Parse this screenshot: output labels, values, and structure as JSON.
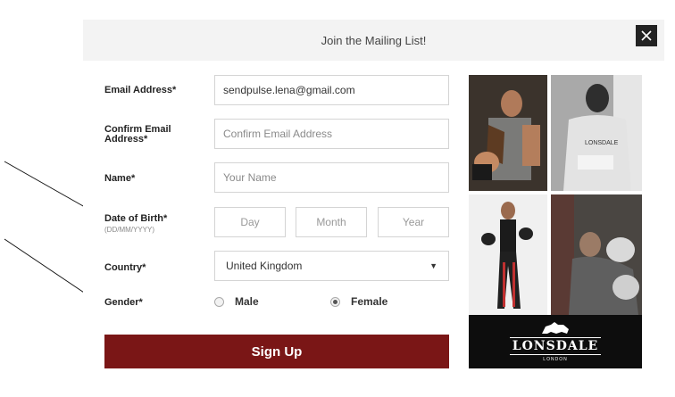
{
  "modal": {
    "title": "Join the Mailing List!",
    "close_icon": "close-icon"
  },
  "form": {
    "email": {
      "label": "Email Address*",
      "value": "sendpulse.lena@gmail.com",
      "placeholder": ""
    },
    "confirm_email": {
      "label": "Confirm Email Address*",
      "value": "",
      "placeholder": "Confirm Email Address"
    },
    "name": {
      "label": "Name*",
      "value": "",
      "placeholder": "Your Name"
    },
    "dob": {
      "label": "Date of Birth*",
      "hint": "(DD/MM/YYYY)",
      "day_placeholder": "Day",
      "month_placeholder": "Month",
      "year_placeholder": "Year"
    },
    "country": {
      "label": "Country*",
      "selected": "United Kingdom",
      "chevron": "chevron-down-icon"
    },
    "gender": {
      "label": "Gender*",
      "options": [
        {
          "label": "Male",
          "checked": false
        },
        {
          "label": "Female",
          "checked": true
        }
      ]
    },
    "submit_label": "Sign Up"
  },
  "brand": {
    "name": "LONSDALE",
    "subtitle": "LONDON"
  },
  "colors": {
    "accent": "#7a1616",
    "header_bg": "#f3f3f3",
    "close_bg": "#222222"
  }
}
